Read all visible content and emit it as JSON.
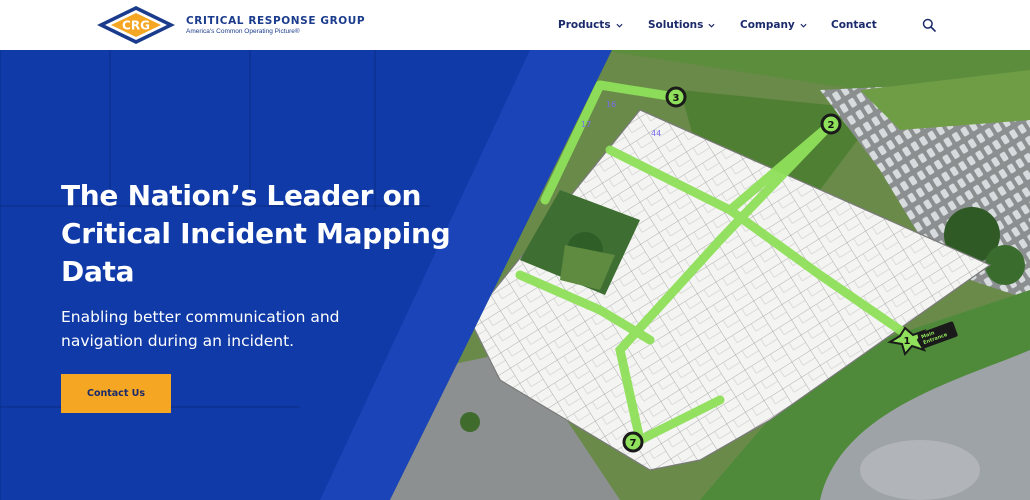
{
  "brand": {
    "logo_initials": "CRG",
    "name": "CRITICAL RESPONSE GROUP",
    "tagline": "America's Common Operating Picture®",
    "colors": {
      "navy": "#1b3b8c",
      "orange": "#f5a623",
      "hero_blue": "#0f3aa8"
    }
  },
  "nav": {
    "items": [
      {
        "label": "Products",
        "has_dropdown": true
      },
      {
        "label": "Solutions",
        "has_dropdown": true
      },
      {
        "label": "Company",
        "has_dropdown": true
      },
      {
        "label": "Contact",
        "has_dropdown": false
      }
    ],
    "search_icon": "search-icon"
  },
  "hero": {
    "title": "The Nation’s Leader on Critical Incident Mapping Data",
    "subtitle": "Enabling better communication and navigation during an incident.",
    "cta_label": "Contact Us",
    "image": {
      "waypoints": [
        "1",
        "2",
        "3",
        "7"
      ],
      "room_numbers": [
        "16",
        "44",
        "17"
      ],
      "entrance_label": "Main Entrance"
    }
  }
}
